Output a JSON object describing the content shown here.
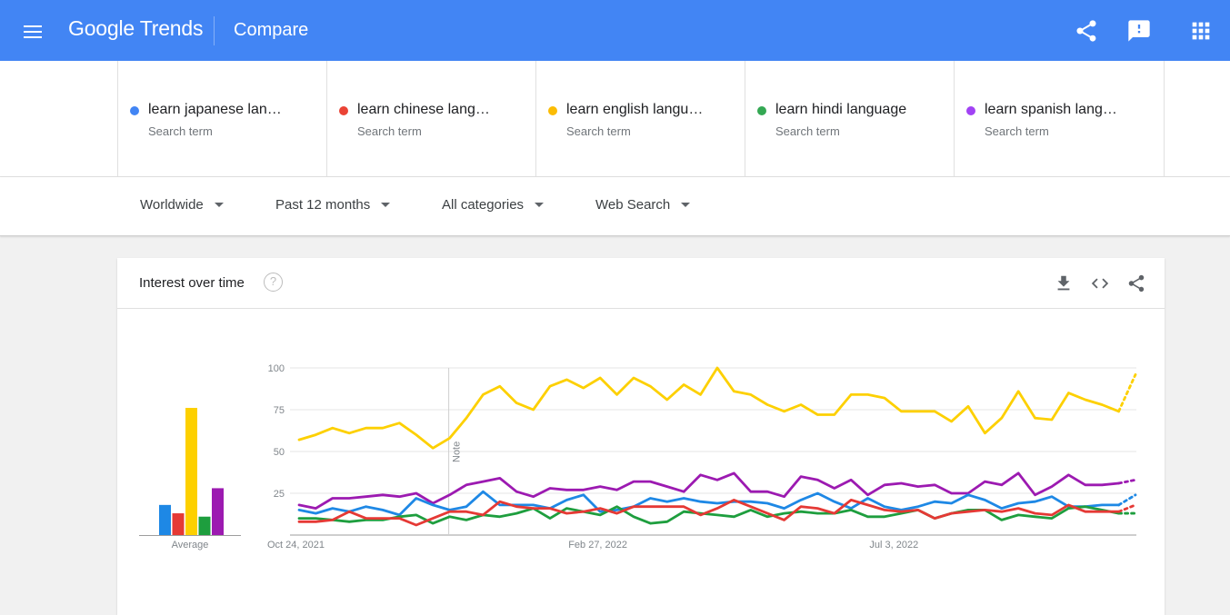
{
  "header": {
    "logo_text": "Google Trends",
    "page_title": "Compare",
    "icons": [
      "menu-icon",
      "share-icon",
      "feedback-icon",
      "apps-icon"
    ]
  },
  "terms": [
    {
      "name": "learn japanese lan…",
      "type": "Search term",
      "color": "#4285f4"
    },
    {
      "name": "learn chinese lang…",
      "type": "Search term",
      "color": "#ea4335"
    },
    {
      "name": "learn english langu…",
      "type": "Search term",
      "color": "#fbbc04"
    },
    {
      "name": "learn hindi language",
      "type": "Search term",
      "color": "#34a853"
    },
    {
      "name": "learn spanish lang…",
      "type": "Search term",
      "color": "#a142f4"
    }
  ],
  "filters": {
    "region": "Worldwide",
    "time": "Past 12 months",
    "category": "All categories",
    "search_type": "Web Search"
  },
  "card": {
    "title": "Interest over time",
    "help": "?",
    "icons": [
      "download-icon",
      "embed-icon",
      "share-icon"
    ]
  },
  "colors": {
    "header": "#4285f4",
    "japanese": "#1e88e5",
    "chinese": "#e53935",
    "english": "#fdd000",
    "hindi": "#1e9e3e",
    "spanish": "#9c1ab1"
  },
  "chart_data": {
    "type": "line",
    "ylim": [
      0,
      100
    ],
    "yticks": [
      25,
      50,
      75,
      100
    ],
    "x_tick_labels": [
      "Oct 24, 2021",
      "Feb 27, 2022",
      "Jul 3, 2022"
    ],
    "x_tick_index": [
      0,
      18,
      36
    ],
    "note_label": "Note",
    "note_index": 9,
    "average_label": "Average",
    "partial_last_point": true,
    "series": [
      {
        "key": "english",
        "color": "#fdd000",
        "average": 76,
        "values": [
          57,
          60,
          64,
          61,
          64,
          64,
          67,
          60,
          52,
          58,
          70,
          84,
          89,
          79,
          75,
          89,
          93,
          88,
          94,
          84,
          94,
          89,
          81,
          90,
          84,
          100,
          86,
          84,
          78,
          74,
          78,
          72,
          72,
          84,
          84,
          82,
          74,
          74,
          74,
          68,
          77,
          61,
          70,
          86,
          70,
          69,
          85,
          81,
          78,
          74,
          96
        ]
      },
      {
        "key": "spanish",
        "color": "#9c1ab1",
        "average": 28,
        "values": [
          18,
          16,
          22,
          22,
          23,
          24,
          23,
          25,
          19,
          24,
          30,
          32,
          34,
          26,
          23,
          28,
          27,
          27,
          29,
          27,
          32,
          32,
          29,
          26,
          36,
          33,
          37,
          26,
          26,
          23,
          35,
          33,
          28,
          33,
          24,
          30,
          31,
          29,
          30,
          25,
          25,
          32,
          30,
          37,
          24,
          29,
          36,
          30,
          30,
          31,
          33
        ]
      },
      {
        "key": "japanese",
        "color": "#1e88e5",
        "average": 18,
        "values": [
          15,
          13,
          16,
          14,
          17,
          15,
          12,
          22,
          18,
          15,
          17,
          26,
          18,
          18,
          18,
          16,
          21,
          24,
          14,
          15,
          17,
          22,
          20,
          22,
          20,
          19,
          20,
          20,
          19,
          16,
          21,
          25,
          20,
          16,
          22,
          17,
          15,
          17,
          20,
          19,
          24,
          21,
          16,
          19,
          20,
          23,
          17,
          17,
          18,
          18,
          24
        ]
      },
      {
        "key": "hindi",
        "color": "#1e9e3e",
        "average": 11,
        "values": [
          10,
          10,
          9,
          8,
          9,
          9,
          11,
          12,
          7,
          11,
          9,
          12,
          11,
          13,
          16,
          10,
          16,
          14,
          12,
          17,
          11,
          7,
          8,
          14,
          13,
          12,
          11,
          15,
          11,
          13,
          14,
          13,
          13,
          15,
          11,
          11,
          13,
          15,
          10,
          13,
          15,
          15,
          9,
          12,
          11,
          10,
          16,
          17,
          15,
          13,
          13
        ]
      },
      {
        "key": "chinese",
        "color": "#e53935",
        "average": 13,
        "values": [
          8,
          8,
          9,
          14,
          10,
          10,
          10,
          6,
          10,
          14,
          14,
          12,
          20,
          17,
          16,
          16,
          13,
          14,
          16,
          13,
          17,
          17,
          17,
          17,
          12,
          16,
          21,
          17,
          13,
          9,
          17,
          16,
          13,
          21,
          18,
          15,
          14,
          15,
          10,
          13,
          14,
          15,
          14,
          16,
          13,
          12,
          18,
          14,
          14,
          14,
          18
        ]
      }
    ]
  }
}
